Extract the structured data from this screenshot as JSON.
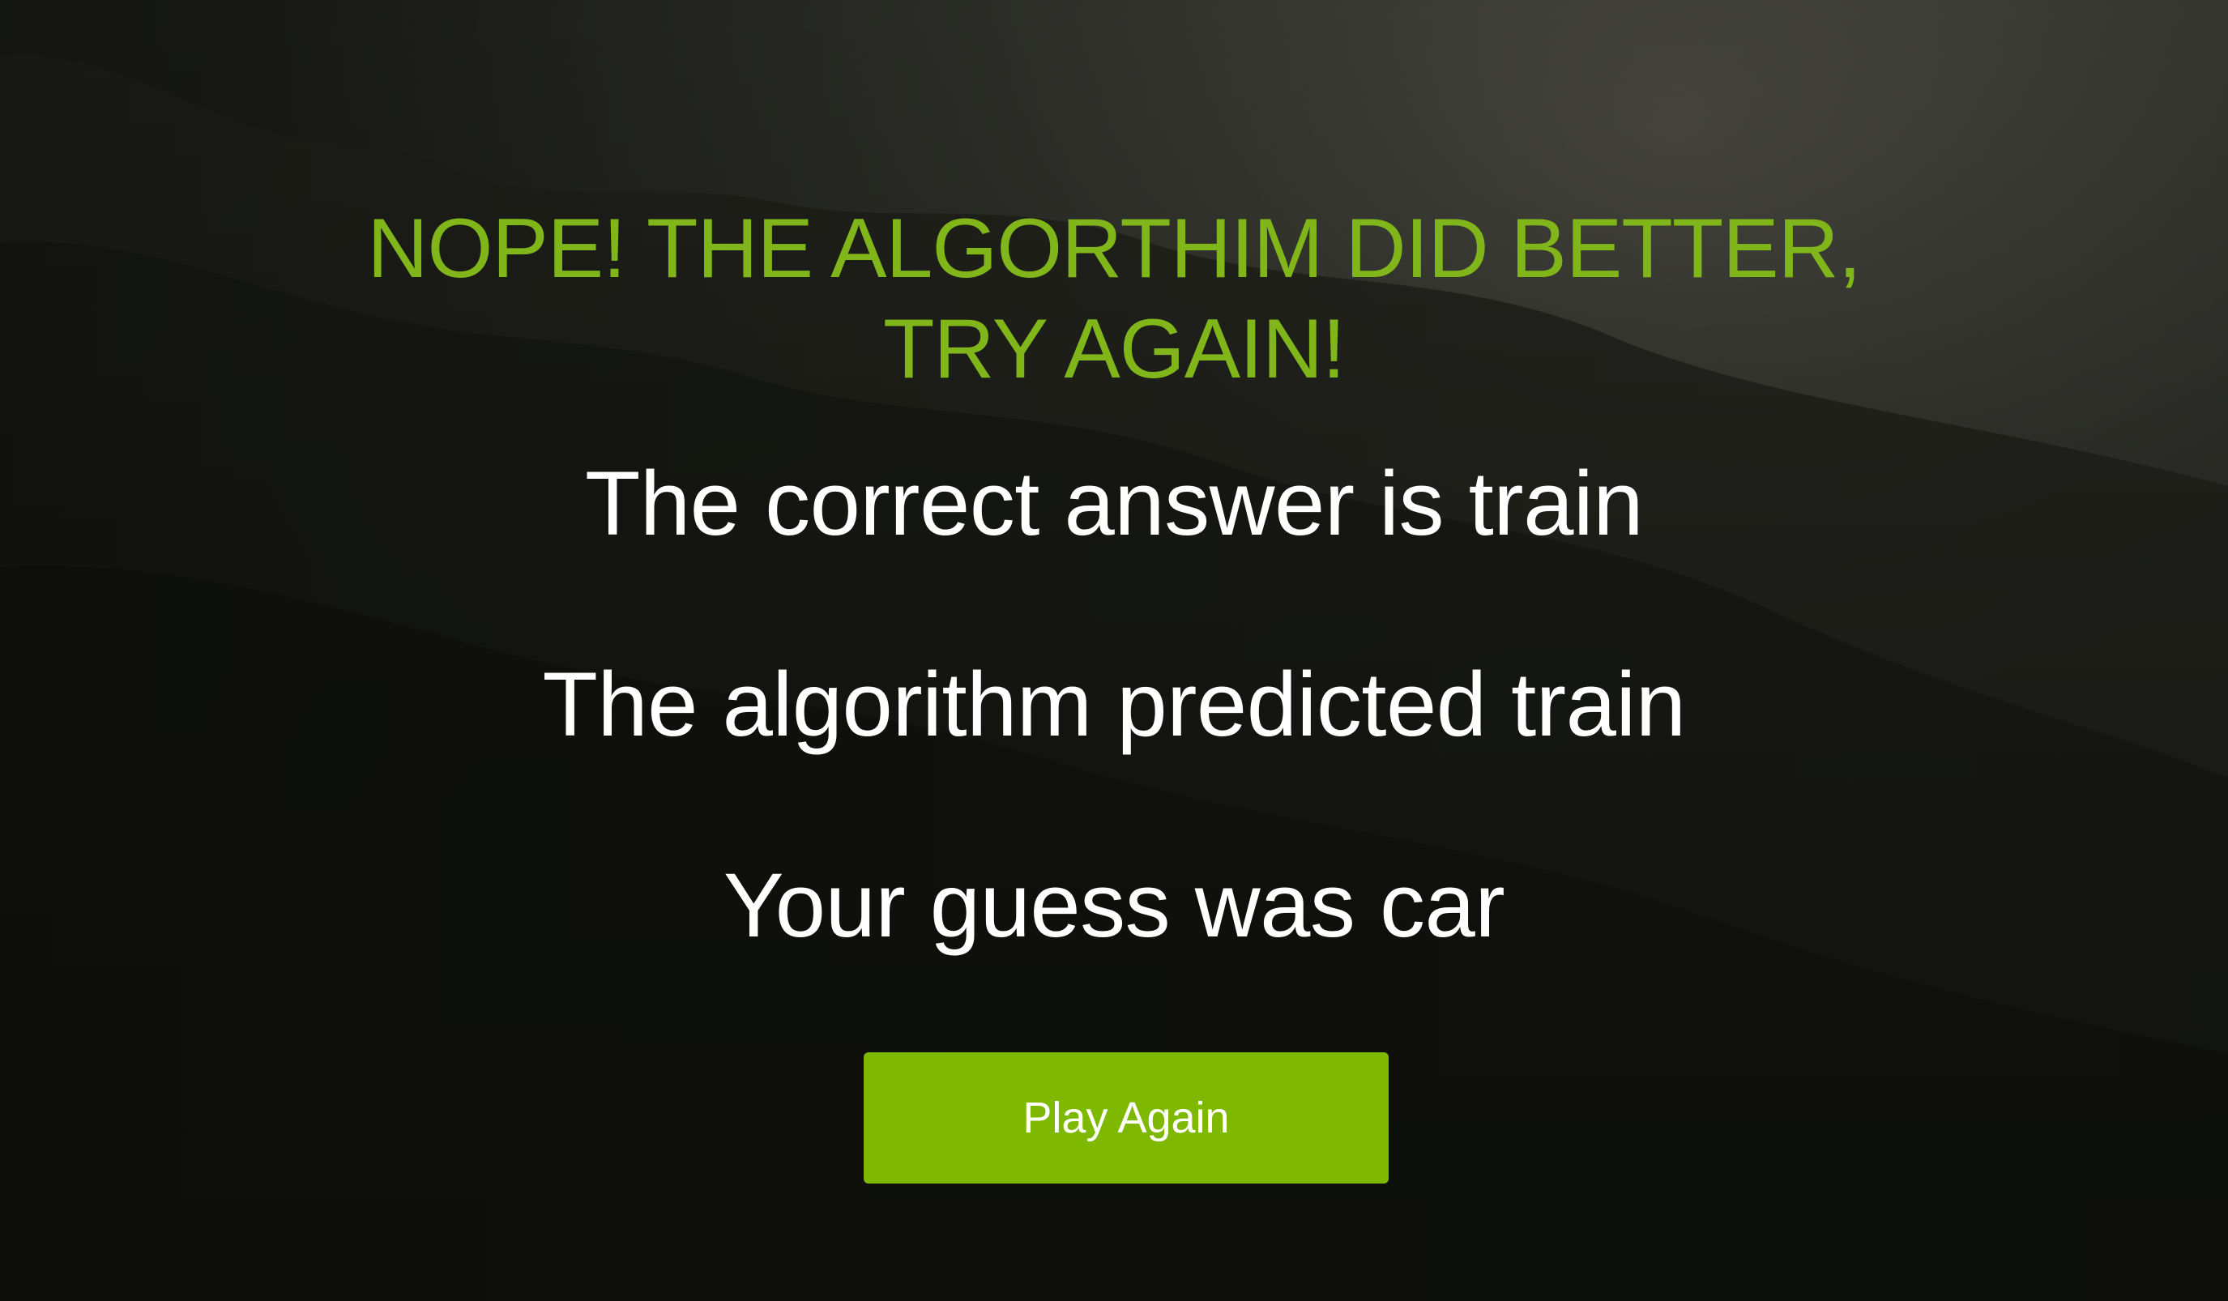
{
  "result": {
    "headline_line1": "NOPE! THE ALGORTHIM DID BETTER,",
    "headline_line2": "TRY AGAIN!",
    "correct_answer": "The correct answer is train",
    "algorithm_prediction": "The algorithm predicted train",
    "user_guess": "Your guess was car"
  },
  "actions": {
    "play_again_label": "Play Again"
  },
  "colors": {
    "accent": "#80b61a",
    "button": "#7fb800",
    "text": "#ffffff",
    "background": "#1a1b17"
  }
}
